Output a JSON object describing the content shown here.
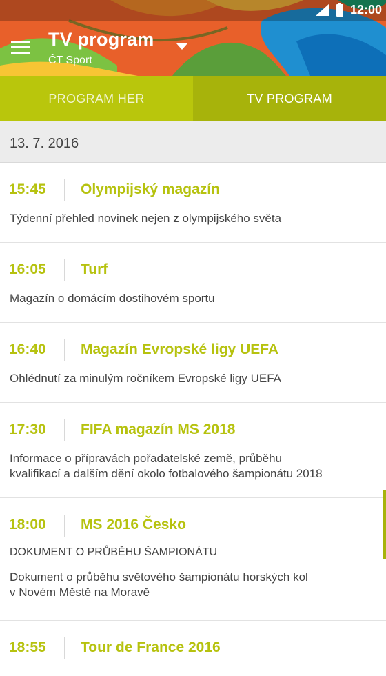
{
  "status": {
    "time": "12:00"
  },
  "header": {
    "title": "TV program",
    "channel": "ČT Sport"
  },
  "tabs": [
    {
      "label": "PROGRAM HER",
      "active": false
    },
    {
      "label": "TV PROGRAM",
      "active": true
    }
  ],
  "date": "13. 7. 2016",
  "programs": [
    {
      "time": "15:45",
      "title": "Olympijský magazín",
      "description": "Týdenní přehled novinek nejen z olympijského světa"
    },
    {
      "time": "16:05",
      "title": "Turf",
      "description": "Magazín o domácím dostihovém sportu"
    },
    {
      "time": "16:40",
      "title": "Magazín Evropské ligy UEFA",
      "description": "Ohlédnutí za minulým ročníkem Evropské ligy UEFA"
    },
    {
      "time": "17:30",
      "title": "FIFA magazín MS 2018",
      "description_lines": [
        "Informace o přípravách pořadatelské země, průběhu",
        "kvalifikací a dalším dění okolo fotbalového šampionátu 2018"
      ]
    },
    {
      "time": "18:00",
      "title": "MS 2016 Česko",
      "subtitle": "DOKUMENT O PRŮBĚHU ŠAMPIONÁTU",
      "description_lines": [
        "Dokument o průběhu světového šampionátu horských kol",
        "v Novém Městě na Moravě"
      ]
    },
    {
      "time": "18:55",
      "title": "Tour de France 2016"
    }
  ],
  "colors": {
    "accent": "#b6c20f",
    "tab_active": "#a7b30b",
    "tab_inactive": "#b9c60c"
  }
}
